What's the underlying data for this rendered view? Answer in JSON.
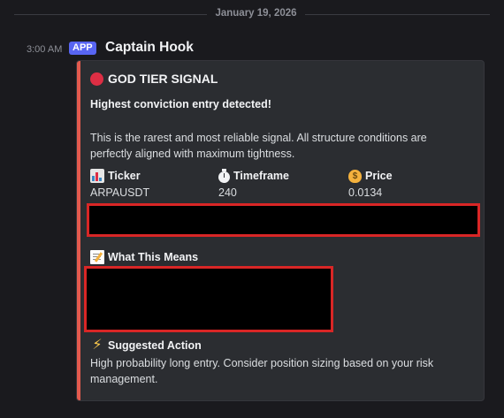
{
  "date_divider": "January 19, 2026",
  "message": {
    "timestamp": "3:00 AM",
    "badge": "APP",
    "author": "Captain Hook"
  },
  "embed": {
    "accent_color": "#e35a4e",
    "title": "GOD TIER SIGNAL",
    "title_icon": "red-circle-icon",
    "subtitle": "Highest conviction entry detected!",
    "description": "This is the rarest and most reliable signal. All structure conditions are perfectly aligned with maximum tightness.",
    "fields": [
      {
        "icon": "bar-chart-icon",
        "name": "Ticker",
        "value": "ARPAUSDT"
      },
      {
        "icon": "stopwatch-icon",
        "name": "Timeframe",
        "value": "240"
      },
      {
        "icon": "money-bag-icon",
        "name": "Price",
        "value": "0.0134"
      }
    ],
    "what_this_means": {
      "icon": "memo-icon",
      "heading": "What This Means"
    },
    "suggested_action": {
      "icon": "lightning-icon",
      "heading": "Suggested Action",
      "text": "High probability long entry. Consider position sizing based on your risk management."
    }
  },
  "colors": {
    "background": "#1a1a1e",
    "embed_background": "#2b2d31",
    "app_badge": "#5865f2",
    "redaction_border": "#d92626"
  }
}
